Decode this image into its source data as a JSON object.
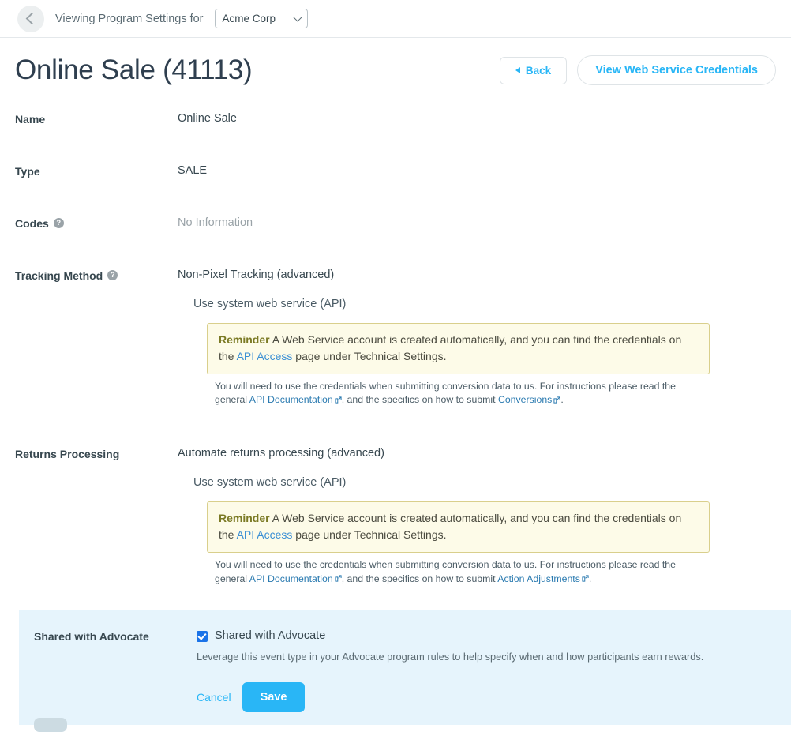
{
  "topbar": {
    "back_icon": "chevron-left-icon",
    "viewing_label": "Viewing Program Settings for",
    "org_value": "Acme Corp",
    "org_caret_icon": "chevron-down-icon"
  },
  "header": {
    "title": "Online Sale (41113)",
    "back_button": "Back",
    "credentials_button": "View Web Service Credentials"
  },
  "form": {
    "rows": [
      {
        "label": "Name",
        "value": "Online Sale",
        "help": false
      },
      {
        "label": "Type",
        "value": "SALE",
        "help": false
      },
      {
        "label": "Codes",
        "value": "No Information",
        "help": true,
        "muted": true
      },
      {
        "label": "Tracking Method",
        "value": "Non-Pixel Tracking (advanced)",
        "help": true
      },
      {
        "label": "Returns Processing",
        "value": "Automate returns processing (advanced)",
        "help": false
      }
    ],
    "sub_line": "Use system web service (API)",
    "reminder": {
      "strong": "Reminder",
      "text_1": " A Web Service account is created automatically, and you can find the credentials on the ",
      "link": "API Access",
      "text_2": " page under Technical Settings."
    },
    "note": {
      "text_1": "You will need to use the credentials when submitting conversion data to us. For instructions please read the general ",
      "link_docs": "API Documentation",
      "text_2": ", and the specifics on how to submit ",
      "link_conversions": "Conversions",
      "link_adjustments": "Action Adjustments",
      "text_3": "."
    }
  },
  "shared": {
    "label": "Shared with Advocate",
    "checkbox_label": "Shared with Advocate",
    "checkbox_checked": true,
    "description": "Leverage this event type in your Advocate program rules to help specify when and how participants earn rewards.",
    "cancel_button": "Cancel",
    "save_button": "Save"
  },
  "colors": {
    "accent": "#29b6f6",
    "checkbox": "#1a73e8",
    "reminder_bg": "#fdfbe8",
    "reminder_border": "#d9cf8c",
    "reminder_strong": "#7b7a24",
    "panel_bg": "#e6f4fc",
    "title": "#2f3f4f"
  }
}
